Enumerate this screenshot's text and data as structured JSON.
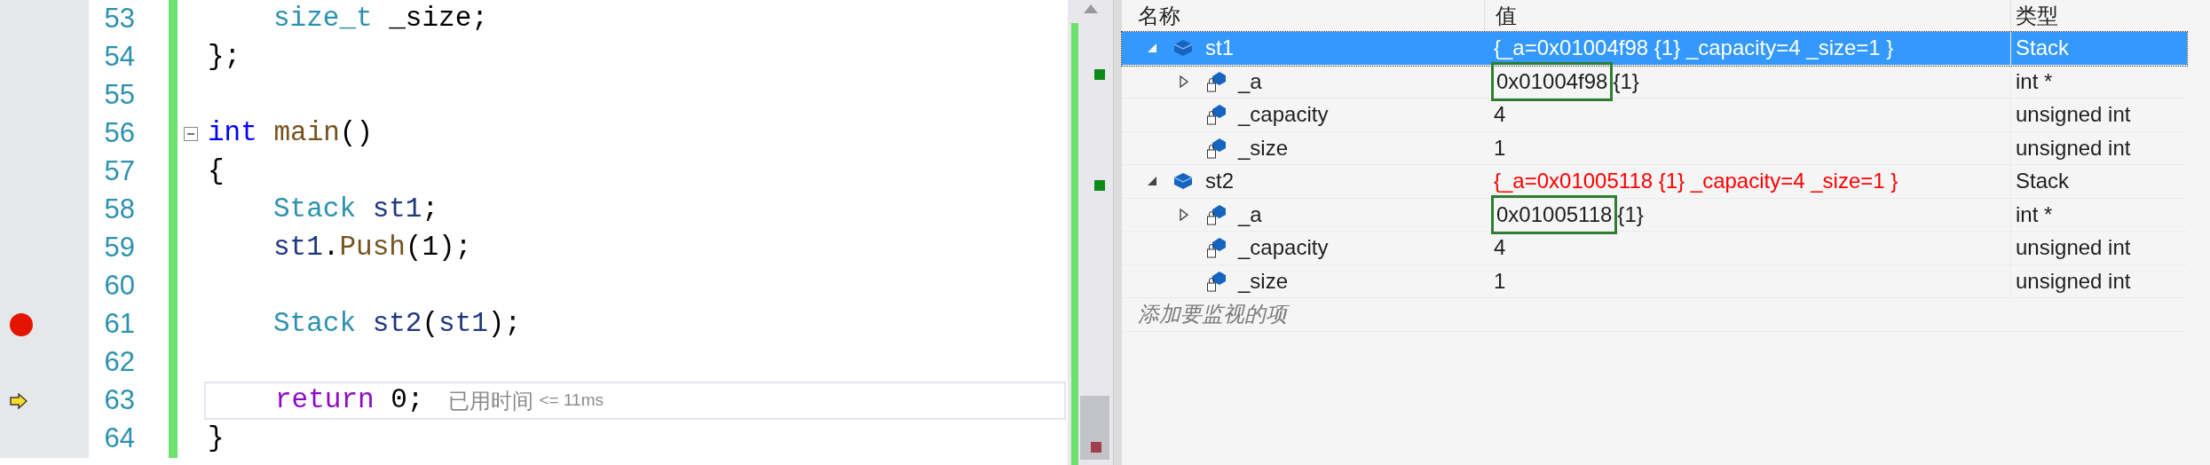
{
  "editor": {
    "lines": [
      {
        "number": "53",
        "breakpoint": false,
        "current": false,
        "indented": true,
        "tokens": [
          {
            "kind": "type",
            "text": "size_t"
          },
          {
            "kind": "plain",
            "text": " _size;"
          }
        ]
      },
      {
        "number": "54",
        "breakpoint": false,
        "current": false,
        "indented": false,
        "tokens": [
          {
            "kind": "plain",
            "text": "};"
          }
        ]
      },
      {
        "number": "55",
        "breakpoint": false,
        "current": false
      },
      {
        "number": "56",
        "breakpoint": false,
        "current": false,
        "collapsible": true,
        "indented": false,
        "tokens": [
          {
            "kind": "keyword",
            "text": "int "
          },
          {
            "kind": "function",
            "text": "main"
          },
          {
            "kind": "plain",
            "text": "()"
          }
        ]
      },
      {
        "number": "57",
        "breakpoint": false,
        "current": false,
        "indented": false,
        "tokens": [
          {
            "kind": "plain",
            "text": "{"
          }
        ]
      },
      {
        "number": "58",
        "breakpoint": false,
        "current": false,
        "indented": true,
        "tokens": [
          {
            "kind": "type",
            "text": "Stack "
          },
          {
            "kind": "variable",
            "text": "st1"
          },
          {
            "kind": "plain",
            "text": ";"
          }
        ]
      },
      {
        "number": "59",
        "breakpoint": false,
        "current": false,
        "indented": true,
        "tokens": [
          {
            "kind": "variable",
            "text": "st1"
          },
          {
            "kind": "plain",
            "text": "."
          },
          {
            "kind": "function",
            "text": "Push"
          },
          {
            "kind": "plain",
            "text": "(1);"
          }
        ]
      },
      {
        "number": "60",
        "breakpoint": false,
        "current": false
      },
      {
        "number": "61",
        "breakpoint": true,
        "current": false,
        "indented": true,
        "tokens": [
          {
            "kind": "type",
            "text": "Stack "
          },
          {
            "kind": "variable",
            "text": "st2"
          },
          {
            "kind": "plain",
            "text": "("
          },
          {
            "kind": "variable",
            "text": "st1"
          },
          {
            "kind": "plain",
            "text": ");"
          }
        ]
      },
      {
        "number": "62",
        "breakpoint": false,
        "current": false
      },
      {
        "number": "63",
        "breakpoint": false,
        "current": true,
        "indented": true,
        "hint": {
          "label": "已用时间",
          "value": "<= 11ms"
        },
        "tokens": [
          {
            "kind": "control",
            "text": "return "
          },
          {
            "kind": "plain",
            "text": "0;"
          }
        ]
      },
      {
        "number": "64",
        "breakpoint": false,
        "current": false,
        "indented": false,
        "tokens": [
          {
            "kind": "plain",
            "text": "}"
          }
        ]
      }
    ]
  },
  "watch": {
    "columns": [
      "名称",
      "值",
      "类型"
    ],
    "rows": [
      {
        "kind": "object",
        "name": "st1",
        "value": "{_a=0x01004f98 {1} _capacity=4 _size=1 }",
        "type": "Stack",
        "selected": true,
        "expanded": true,
        "changed": false,
        "children": [
          {
            "kind": "field",
            "name": "_a",
            "value": "0x01004f98",
            "detail": "{1}",
            "outlined": true,
            "type": "int *",
            "selected": false,
            "expanded": false,
            "changed": false
          },
          {
            "kind": "field",
            "name": "_capacity",
            "value": "4",
            "outlined": false,
            "type": "unsigned int",
            "selected": false,
            "changed": false
          },
          {
            "kind": "field",
            "name": "_size",
            "value": "1",
            "outlined": false,
            "type": "unsigned int",
            "selected": false,
            "changed": false
          }
        ]
      },
      {
        "kind": "object",
        "name": "st2",
        "value": "{_a=0x01005118 {1} _capacity=4 _size=1 }",
        "type": "Stack",
        "selected": false,
        "expanded": true,
        "changed": true,
        "children": [
          {
            "kind": "field",
            "name": "_a",
            "value": "0x01005118",
            "detail": "{1}",
            "outlined": true,
            "type": "int *",
            "selected": false,
            "expanded": false,
            "changed": false
          },
          {
            "kind": "field",
            "name": "_capacity",
            "value": "4",
            "outlined": false,
            "type": "unsigned int",
            "selected": false,
            "changed": false
          },
          {
            "kind": "field",
            "name": "_size",
            "value": "1",
            "outlined": false,
            "type": "unsigned int",
            "selected": false,
            "changed": false
          }
        ]
      }
    ],
    "placeholder": "添加要监视的项"
  }
}
